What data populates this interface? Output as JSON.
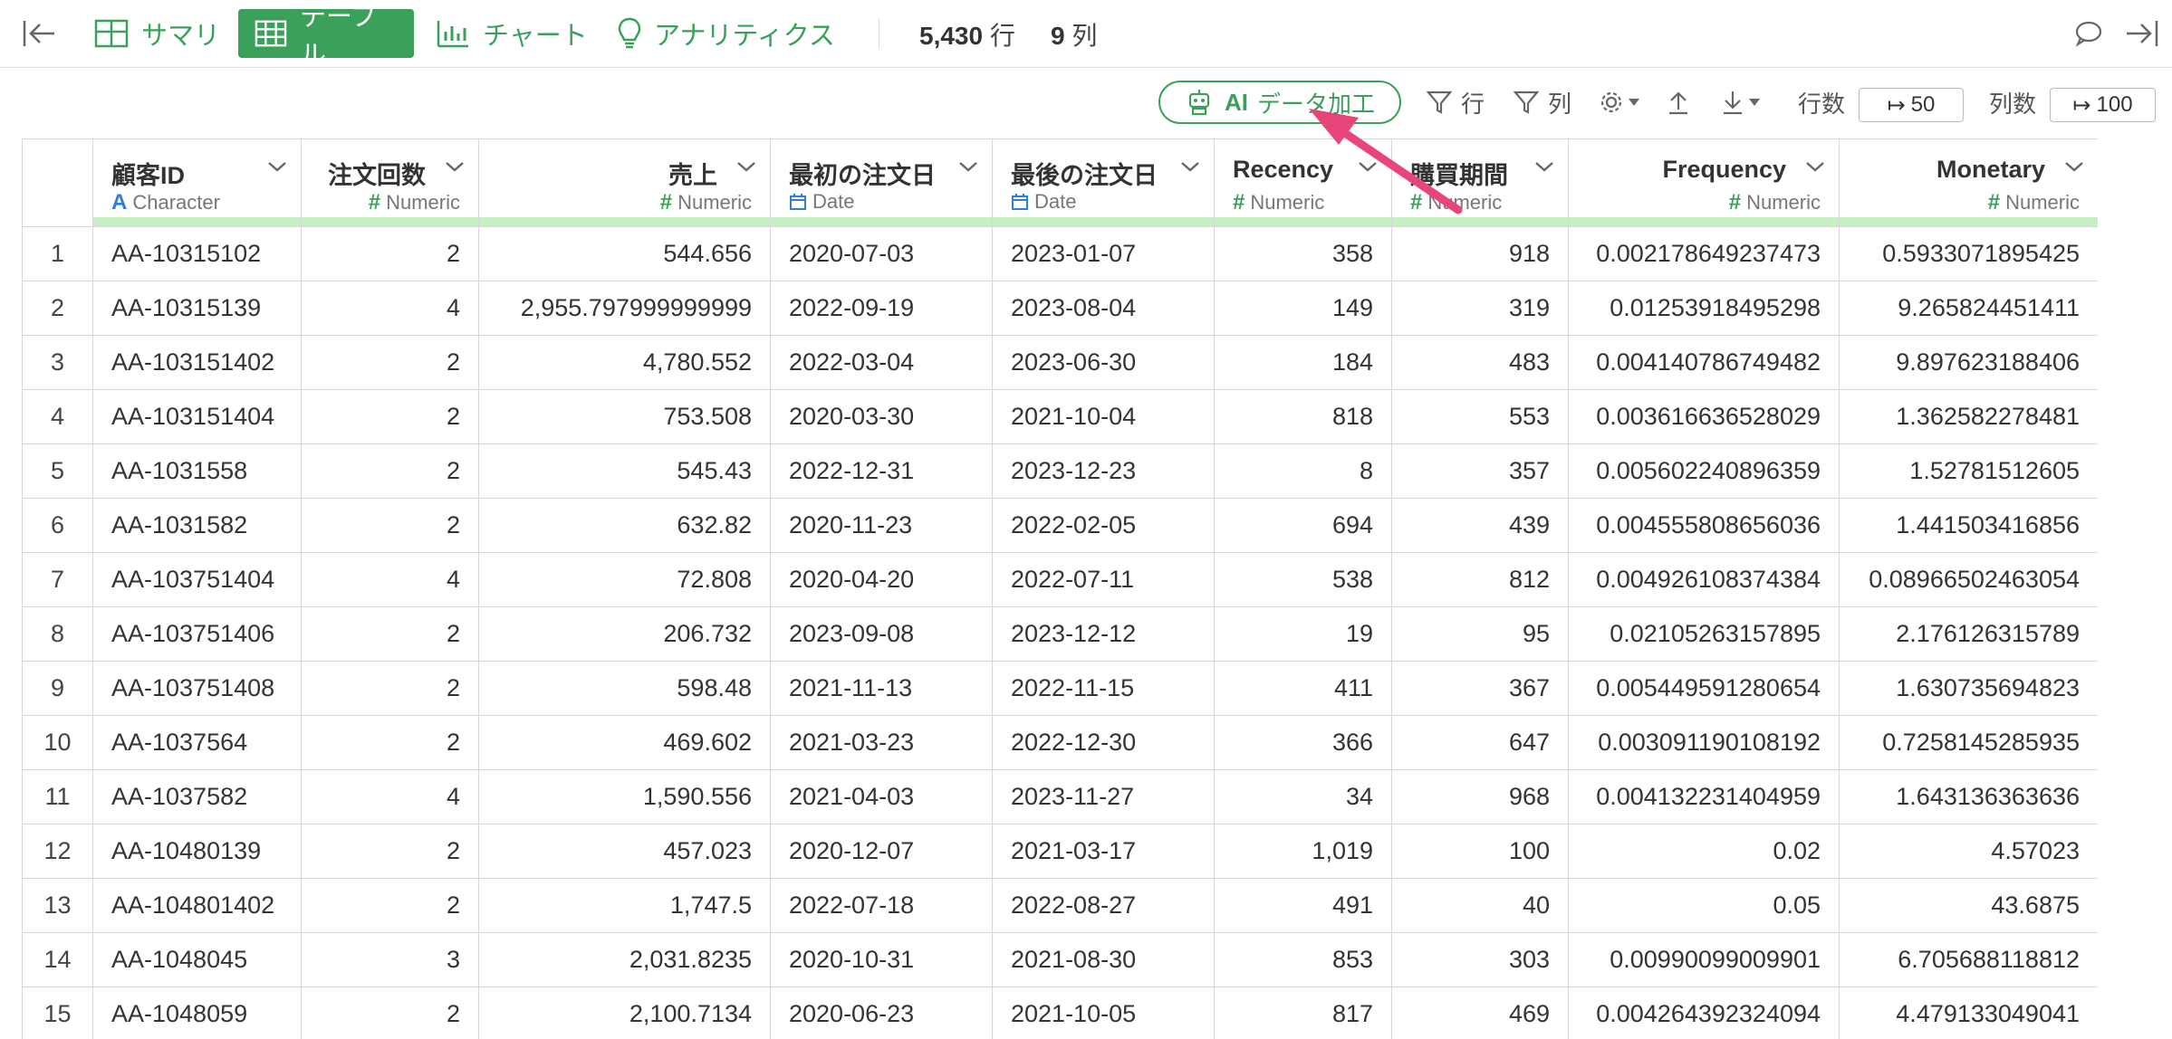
{
  "topbar": {
    "tabs": [
      {
        "label": "サマリ"
      },
      {
        "label": "テーブル"
      },
      {
        "label": "チャート"
      },
      {
        "label": "アナリティクス"
      }
    ],
    "row_count": "5,430",
    "row_unit": "行",
    "col_count": "9",
    "col_unit": "列"
  },
  "toolbar": {
    "ai_label_prefix": "AI",
    "ai_label": "データ加工",
    "row_filter_label": "行",
    "col_filter_label": "列",
    "rows_label": "行数",
    "rows_value": "50",
    "cols_label": "列数",
    "cols_value": "100"
  },
  "columns": [
    {
      "name": "顧客ID",
      "type": "Character"
    },
    {
      "name": "注文回数",
      "type": "Numeric"
    },
    {
      "name": "売上",
      "type": "Numeric"
    },
    {
      "name": "最初の注文日",
      "type": "Date"
    },
    {
      "name": "最後の注文日",
      "type": "Date"
    },
    {
      "name": "Recency",
      "type": "Numeric"
    },
    {
      "name": "購買期間",
      "type": "Numeric"
    },
    {
      "name": "Frequency",
      "type": "Numeric"
    },
    {
      "name": "Monetary",
      "type": "Numeric"
    }
  ],
  "rows": [
    [
      "1",
      "AA-10315102",
      "2",
      "544.656",
      "2020-07-03",
      "2023-01-07",
      "358",
      "918",
      "0.002178649237473",
      "0.5933071895425"
    ],
    [
      "2",
      "AA-10315139",
      "4",
      "2,955.797999999999",
      "2022-09-19",
      "2023-08-04",
      "149",
      "319",
      "0.01253918495298",
      "9.265824451411"
    ],
    [
      "3",
      "AA-103151402",
      "2",
      "4,780.552",
      "2022-03-04",
      "2023-06-30",
      "184",
      "483",
      "0.004140786749482",
      "9.897623188406"
    ],
    [
      "4",
      "AA-103151404",
      "2",
      "753.508",
      "2020-03-30",
      "2021-10-04",
      "818",
      "553",
      "0.003616636528029",
      "1.362582278481"
    ],
    [
      "5",
      "AA-1031558",
      "2",
      "545.43",
      "2022-12-31",
      "2023-12-23",
      "8",
      "357",
      "0.005602240896359",
      "1.52781512605"
    ],
    [
      "6",
      "AA-1031582",
      "2",
      "632.82",
      "2020-11-23",
      "2022-02-05",
      "694",
      "439",
      "0.004555808656036",
      "1.441503416856"
    ],
    [
      "7",
      "AA-103751404",
      "4",
      "72.808",
      "2020-04-20",
      "2022-07-11",
      "538",
      "812",
      "0.004926108374384",
      "0.08966502463054"
    ],
    [
      "8",
      "AA-103751406",
      "2",
      "206.732",
      "2023-09-08",
      "2023-12-12",
      "19",
      "95",
      "0.02105263157895",
      "2.176126315789"
    ],
    [
      "9",
      "AA-103751408",
      "2",
      "598.48",
      "2021-11-13",
      "2022-11-15",
      "411",
      "367",
      "0.005449591280654",
      "1.630735694823"
    ],
    [
      "10",
      "AA-1037564",
      "2",
      "469.602",
      "2021-03-23",
      "2022-12-30",
      "366",
      "647",
      "0.003091190108192",
      "0.7258145285935"
    ],
    [
      "11",
      "AA-1037582",
      "4",
      "1,590.556",
      "2021-04-03",
      "2023-11-27",
      "34",
      "968",
      "0.004132231404959",
      "1.643136363636"
    ],
    [
      "12",
      "AA-10480139",
      "2",
      "457.023",
      "2020-12-07",
      "2021-03-17",
      "1,019",
      "100",
      "0.02",
      "4.57023"
    ],
    [
      "13",
      "AA-104801402",
      "2",
      "1,747.5",
      "2022-07-18",
      "2022-08-27",
      "491",
      "40",
      "0.05",
      "43.6875"
    ],
    [
      "14",
      "AA-1048045",
      "3",
      "2,031.8235",
      "2020-10-31",
      "2021-08-30",
      "853",
      "303",
      "0.00990099009901",
      "6.705688118812"
    ],
    [
      "15",
      "AA-1048059",
      "2",
      "2,100.7134",
      "2020-06-23",
      "2021-10-05",
      "817",
      "469",
      "0.004264392324094",
      "4.479133049041"
    ]
  ],
  "colors": {
    "accent": "#3aa05a",
    "header_bar": "#c6f0c2",
    "annotation_arrow": "#e8457a"
  }
}
